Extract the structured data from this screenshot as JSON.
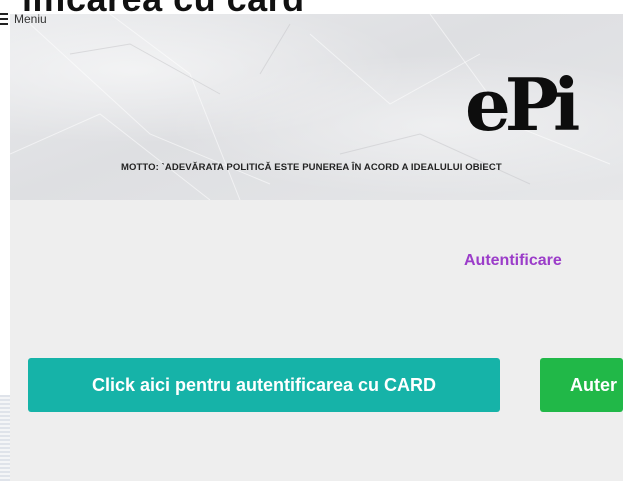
{
  "page": {
    "heading_clipped": "lificarea cu card"
  },
  "header": {
    "menu_label": "Meniu",
    "logo_text": "ePi",
    "motto": "MOTTO: `ADEVĂRATA POLITICĂ ESTE PUNEREA ÎN ACORD A IDEALULUI OBIECT"
  },
  "main": {
    "auth_link": "Autentificare",
    "card_button": "Click aici pentru autentificarea cu CARD",
    "auth_button": "Auter"
  },
  "colors": {
    "link_purple": "#9b3cc9",
    "card_button_teal": "#16b3a8",
    "auth_button_green": "#21b848",
    "content_bg": "#eeeeee"
  },
  "icons": {
    "menu": "hamburger-icon"
  }
}
